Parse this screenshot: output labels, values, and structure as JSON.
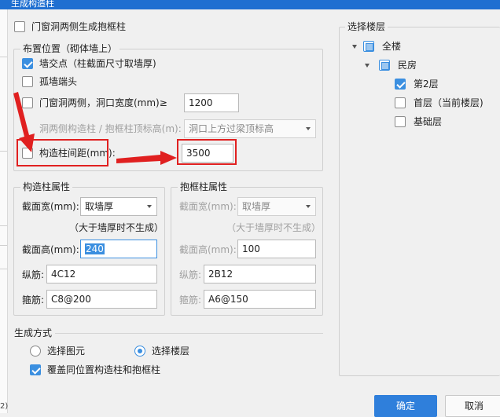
{
  "dialog": {
    "title": "生成构造柱"
  },
  "options": {
    "door_window_label": "门窗洞两侧生成抱框柱",
    "door_window_checked": false
  },
  "placement": {
    "title": "布置位置（砌体墙上）",
    "wall_intersection": {
      "label": "墙交点（柱截面尺寸取墙厚)",
      "checked": true
    },
    "isolated_wall_end": {
      "label": "孤墙端头",
      "checked": false
    },
    "door_window_sides": {
      "label": "门窗洞两侧，洞口宽度(mm)≥",
      "checked": false,
      "value": "1200"
    },
    "top_elevation": {
      "label": "洞两侧构造柱 / 抱框柱顶标高(m):",
      "value": "洞口上方过梁顶标高"
    },
    "column_spacing": {
      "label": "构造柱间距(mm):",
      "checked": false,
      "value": "3500"
    }
  },
  "construction_column": {
    "title": "构造柱属性",
    "section_width": {
      "label": "截面宽(mm):",
      "value": "取墙厚"
    },
    "note": "（大于墙厚时不生成）",
    "section_height": {
      "label": "截面高(mm):",
      "value": "240"
    },
    "long_rebar": {
      "label": "纵筋:",
      "value": "4C12"
    },
    "stirrup": {
      "label": "箍筋:",
      "value": "C8@200"
    }
  },
  "frame_column": {
    "title": "抱框柱属性",
    "section_width": {
      "label": "截面宽(mm):",
      "value": "取墙厚"
    },
    "note": "（大于墙厚时不生成）",
    "section_height": {
      "label": "截面高(mm):",
      "value": "100"
    },
    "long_rebar": {
      "label": "纵筋:",
      "value": "2B12"
    },
    "stirrup": {
      "label": "箍筋:",
      "value": "A6@150"
    }
  },
  "generation": {
    "title": "生成方式",
    "mode_options": [
      {
        "label": "选择图元",
        "selected": false
      },
      {
        "label": "选择楼层",
        "selected": true
      }
    ],
    "overwrite": {
      "label": "覆盖同位置构造柱和抱框柱",
      "checked": true
    }
  },
  "floors": {
    "title": "选择楼层",
    "tree": [
      {
        "label": "全楼",
        "state": "partial",
        "level": 0,
        "expandable": true
      },
      {
        "label": "民房",
        "state": "partial",
        "level": 1,
        "expandable": true
      },
      {
        "label": "第2层",
        "state": "checked",
        "level": 2
      },
      {
        "label": "首层（当前楼层)",
        "state": "unchecked",
        "level": 2
      },
      {
        "label": "基础层",
        "state": "unchecked",
        "level": 2
      }
    ]
  },
  "footer": {
    "ok_label": "确定",
    "cancel_label": "取消"
  },
  "left_strip_tag": "2)",
  "colors": {
    "accent": "#3b8fe0",
    "primary_button": "#2f7fdb",
    "highlight": "#e02020",
    "titlebar": "#1f6fd1"
  }
}
